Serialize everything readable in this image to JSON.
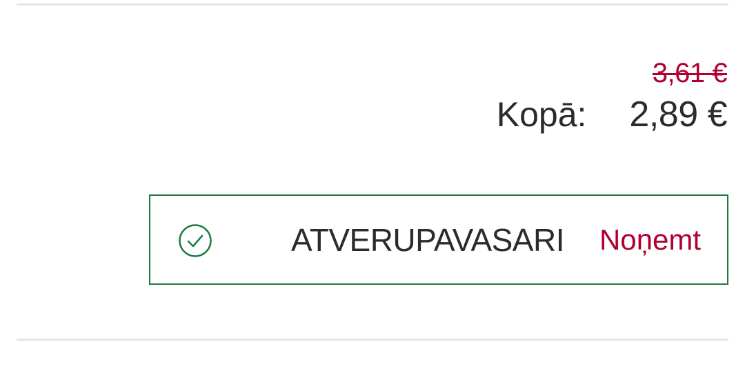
{
  "summary": {
    "old_price": "3,61 €",
    "total_label": "Kopā:",
    "total_value": "2,89 €"
  },
  "coupon": {
    "icon": "check-circle-icon",
    "code": "ATVERUPAVASARI",
    "remove_label": "Noņemt"
  },
  "colors": {
    "accent_red": "#b00032",
    "success_green": "#1f7a3f",
    "text_dark": "#2b2b2b",
    "divider": "#e4e4ea"
  }
}
